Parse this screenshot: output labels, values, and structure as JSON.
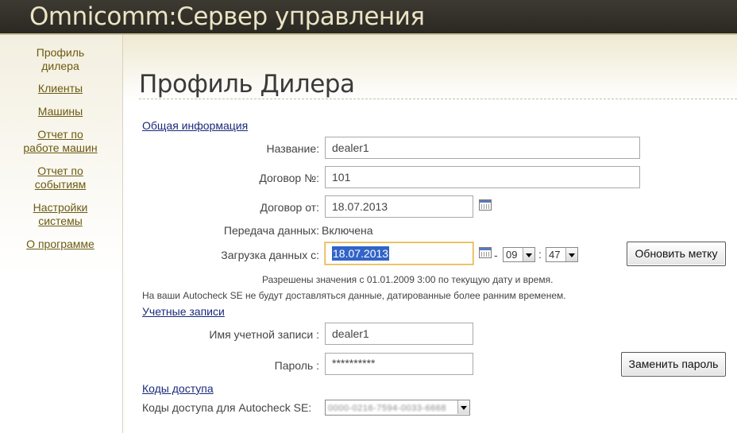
{
  "header": {
    "title": "Omnicomm:Сервер управления"
  },
  "sidebar": {
    "items": [
      {
        "label": "Профиль\nдилера",
        "active": true
      },
      {
        "label": "Клиенты"
      },
      {
        "label": "Машины"
      },
      {
        "label": "Отчет по\nработе машин"
      },
      {
        "label": "Отчет по\nсобытиям"
      },
      {
        "label": "Настройки\nсистемы"
      },
      {
        "label": "О программе"
      }
    ]
  },
  "main": {
    "title": "Профиль Дилера",
    "general": {
      "section_label": "Общая информация",
      "name_label": "Название:",
      "name_value": "dealer1",
      "contract_no_label": "Договор №:",
      "contract_no_value": "101",
      "contract_date_label": "Договор от:",
      "contract_date_value": "18.07.2013",
      "data_transfer_label": "Передача данных:",
      "data_transfer_value": "Включена",
      "load_from_label": "Загрузка данных с:",
      "load_from_date": "18.07.2013",
      "time_sep_dash": "-",
      "hour_value": "09",
      "time_sep_colon": ":",
      "minute_value": "47",
      "update_button": "Обновить метку",
      "hint1": "Разрешены значения с 01.01.2009 3:00 по текущую дату и время.",
      "hint2": "На ваши Autocheck SE не будут доставляться данные, датированные более ранним временем."
    },
    "accounts": {
      "section_label": "Учетные записи",
      "login_label": "Имя учетной записи :",
      "login_value": "dealer1",
      "password_label": "Пароль :",
      "password_value": "**********",
      "change_password_button": "Заменить пароль"
    },
    "access": {
      "section_label": "Коды доступа",
      "codes_label": "Коды доступа для Autocheck SE:",
      "codes_value": "0000-0216-7594-0033-6668"
    }
  },
  "colors": {
    "header_bg": "#2f2c26",
    "header_text": "#ebe4c5",
    "nav_text": "#6b5a10",
    "section_link": "#1a2a7a",
    "selection": "#3264c8",
    "focus_border": "#e8b64a"
  }
}
